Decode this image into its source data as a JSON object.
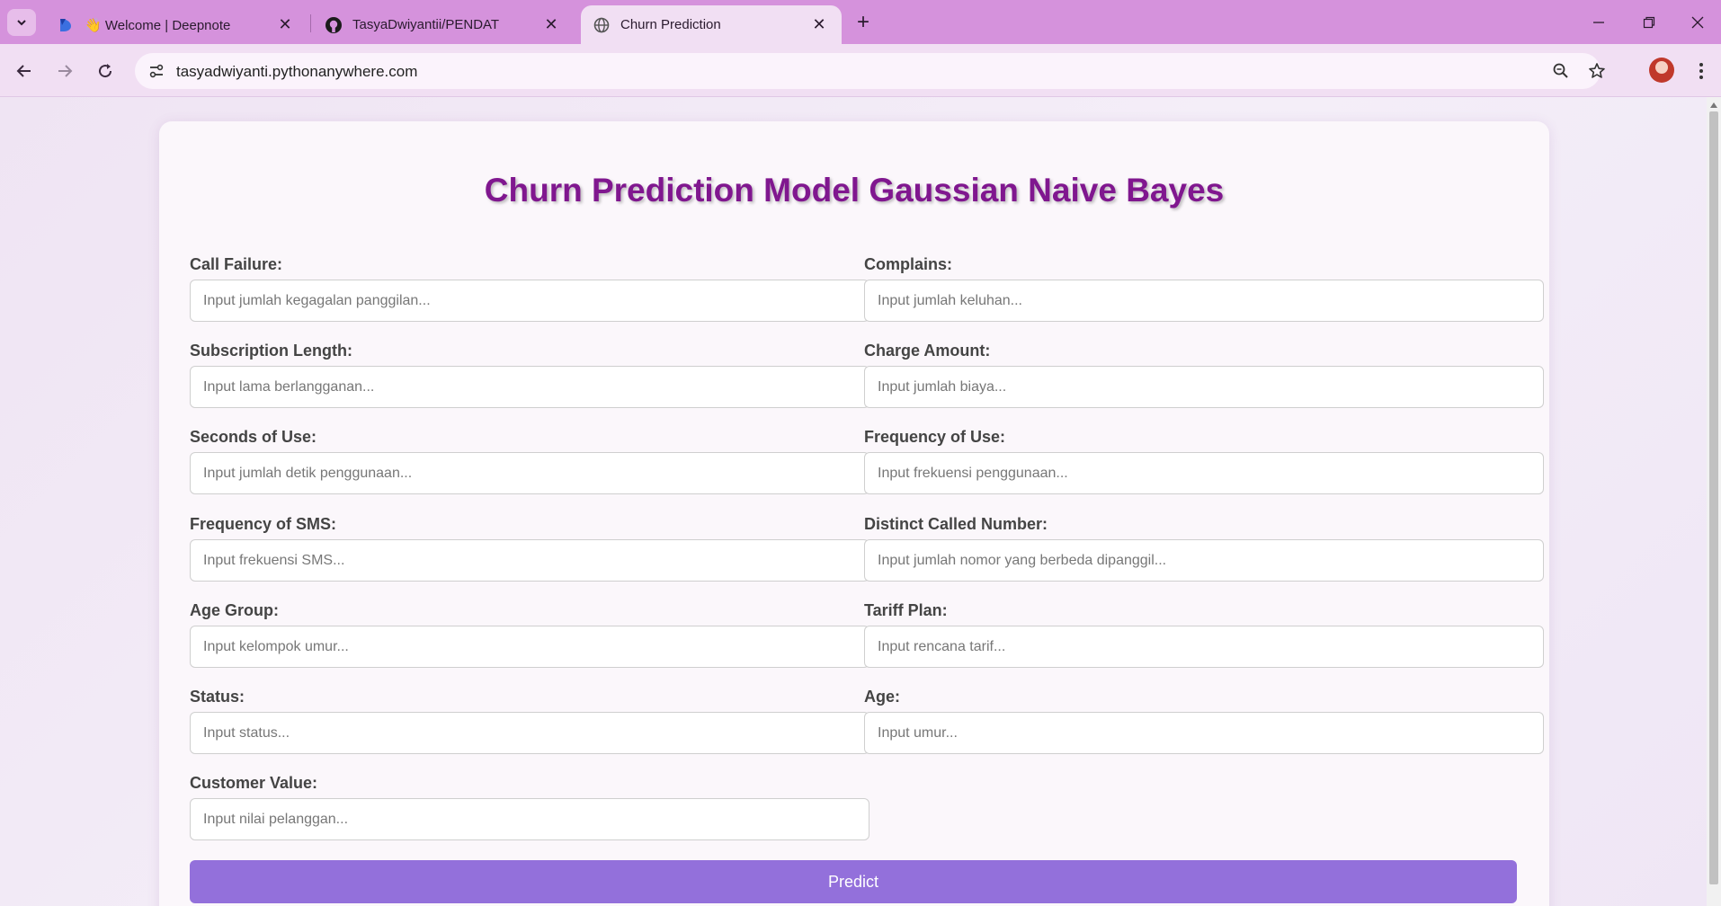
{
  "browser": {
    "tabs": [
      {
        "title": "👋 Welcome | Deepnote",
        "icon": "deepnote-icon",
        "active": false
      },
      {
        "title": "TasyaDwiyantii/PENDAT",
        "icon": "github-icon",
        "active": false
      },
      {
        "title": "Churn Prediction",
        "icon": "globe-icon",
        "active": true
      }
    ],
    "url": "tasyadwiyanti.pythonanywhere.com",
    "accent": "#d592dc"
  },
  "page": {
    "title": "Churn Prediction Model Gaussian Naive Bayes",
    "title_color": "#80178f",
    "button_color": "#9370db",
    "fields": [
      {
        "label": "Call Failure:",
        "placeholder": "Input jumlah kegagalan panggilan..."
      },
      {
        "label": "Complains:",
        "placeholder": "Input jumlah keluhan..."
      },
      {
        "label": "Subscription Length:",
        "placeholder": "Input lama berlangganan..."
      },
      {
        "label": "Charge Amount:",
        "placeholder": "Input jumlah biaya..."
      },
      {
        "label": "Seconds of Use:",
        "placeholder": "Input jumlah detik penggunaan..."
      },
      {
        "label": "Frequency of Use:",
        "placeholder": "Input frekuensi penggunaan..."
      },
      {
        "label": "Frequency of SMS:",
        "placeholder": "Input frekuensi SMS..."
      },
      {
        "label": "Distinct Called Number:",
        "placeholder": "Input jumlah nomor yang berbeda dipanggil..."
      },
      {
        "label": "Age Group:",
        "placeholder": "Input kelompok umur..."
      },
      {
        "label": "Tariff Plan:",
        "placeholder": "Input rencana tarif..."
      },
      {
        "label": "Status:",
        "placeholder": "Input status..."
      },
      {
        "label": "Age:",
        "placeholder": "Input umur..."
      },
      {
        "label": "Customer Value:",
        "placeholder": "Input nilai pelanggan..."
      }
    ],
    "submit_label": "Predict"
  }
}
